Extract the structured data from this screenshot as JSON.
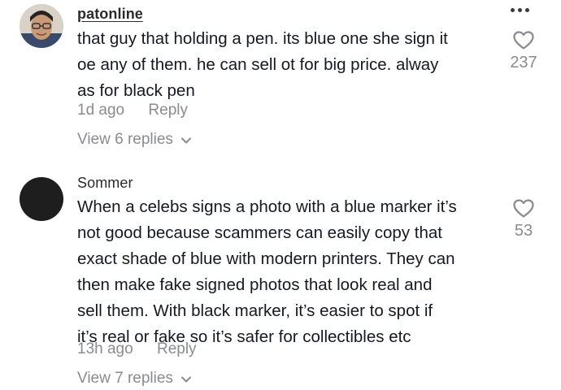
{
  "comments": [
    {
      "username": "patonline",
      "lines": [
        "that guy that holding a pen. its blue one she sign it",
        "oe any of them. he can sell ot for big price. alway",
        "as for black pen"
      ],
      "time": "1d ago",
      "reply_label": "Reply",
      "view_replies": "View 6 replies",
      "likes": "237",
      "icon": "heart-outline-icon"
    },
    {
      "username": "Sommer",
      "lines": [
        "When a celebs signs a photo with a blue marker it’s",
        "not good because scammers can easily copy that",
        "exact shade of blue with modern printers. They can",
        "then make fake signed photos that look real and",
        "sell them. With black marker, it’s easier to spot if",
        "it’s real or fake so it’s safer for collectibles etc"
      ],
      "time": "13h ago",
      "reply_label": "Reply",
      "view_replies": "View 7 replies",
      "likes": "53",
      "icon": "heart-outline-icon"
    }
  ],
  "more_menu_icon": "more-dots-icon",
  "colors": {
    "text": "#161823",
    "secondary": "#8a8b91"
  }
}
